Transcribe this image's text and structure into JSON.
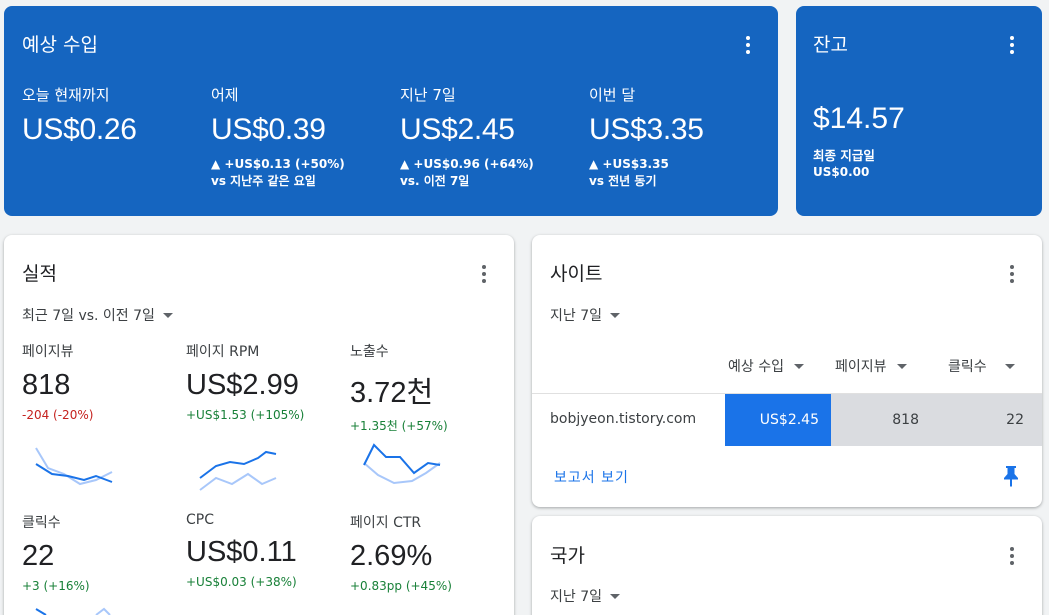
{
  "earnings": {
    "title": "예상 수입",
    "columns": [
      {
        "label": "오늘 현재까지",
        "value": "US$0.26",
        "delta": "",
        "compare": ""
      },
      {
        "label": "어제",
        "value": "US$0.39",
        "delta": "▲ +US$0.13 (+50%)",
        "compare": "vs 지난주 같은 요일"
      },
      {
        "label": "지난 7일",
        "value": "US$2.45",
        "delta": "▲ +US$0.96 (+64%)",
        "compare": "vs. 이전 7일"
      },
      {
        "label": "이번 달",
        "value": "US$3.35",
        "delta": "▲ +US$3.35",
        "compare": "vs 전년 동기"
      }
    ]
  },
  "balance": {
    "title": "잔고",
    "value": "$14.57",
    "last_payment_label": "최종 지급일",
    "last_payment_amount": "US$0.00"
  },
  "performance": {
    "title": "실적",
    "range": "최근 7일 vs. 이전 7일",
    "metrics": [
      {
        "label": "페이지뷰",
        "value": "818",
        "delta": "-204 (-20%)",
        "trend": "negative"
      },
      {
        "label": "페이지 RPM",
        "value": "US$2.99",
        "delta": "+US$1.53 (+105%)",
        "trend": "positive"
      },
      {
        "label": "노출수",
        "value": "3.72천",
        "delta": "+1.35천 (+57%)",
        "trend": "positive"
      },
      {
        "label": "클릭수",
        "value": "22",
        "delta": "+3 (+16%)",
        "trend": "positive"
      },
      {
        "label": "CPC",
        "value": "US$0.11",
        "delta": "+US$0.03 (+38%)",
        "trend": "positive"
      },
      {
        "label": "페이지 CTR",
        "value": "2.69%",
        "delta": "+0.83pp (+45%)",
        "trend": "positive"
      }
    ]
  },
  "sites": {
    "title": "사이트",
    "range": "지난 7일",
    "columns": [
      "예상 수입",
      "페이지뷰",
      "클릭수"
    ],
    "rows": [
      {
        "site": "bobjyeon.tistory.com",
        "earnings": "US$2.45",
        "pageviews": "818",
        "clicks": "22"
      }
    ],
    "report_link": "보고서 보기"
  },
  "countries": {
    "title": "국가",
    "range": "지난 7일"
  },
  "colors": {
    "primary_blue": "#1565c0",
    "accent_blue": "#1a73e8",
    "positive": "#188038",
    "negative": "#c5221f",
    "spark_current": "#1a73e8",
    "spark_previous": "#a8c7fa"
  }
}
